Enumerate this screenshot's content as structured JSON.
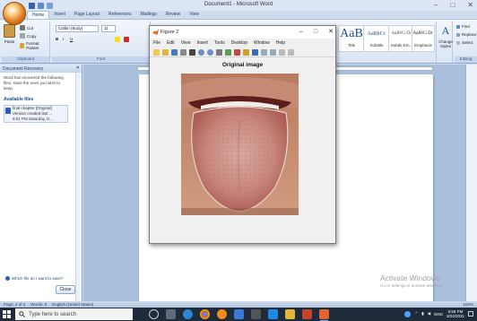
{
  "word": {
    "title": "Document1 - Microsoft Word",
    "window_controls": [
      "–",
      "□",
      "✕"
    ],
    "tabs": [
      "Home",
      "Insert",
      "Page Layout",
      "References",
      "Mailings",
      "Review",
      "View"
    ],
    "ribbon": {
      "clipboard": {
        "paste": "Paste",
        "cut": "Cut",
        "copy": "Copy",
        "format_painter": "Format Painter",
        "label": "Clipboard"
      },
      "font": {
        "name": "Calibri (Body)",
        "size": "11",
        "bold": "B",
        "italic": "I",
        "underline": "U",
        "label": "Font"
      },
      "styles": [
        {
          "sample": "AaB",
          "name": "Title"
        },
        {
          "sample": "AaBbCc",
          "name": "Subtitle"
        },
        {
          "sample": "AaBbCcDc",
          "name": "Subtle Em..."
        },
        {
          "sample": "AaBbCcDc",
          "name": "Emphasis"
        }
      ],
      "change_styles": "Change Styles",
      "editing": {
        "find": "Find",
        "replace": "Replace",
        "select": "Select",
        "label": "Editing"
      }
    },
    "recovery": {
      "title": "Document Recovery",
      "close_x": "✕",
      "description": "Word has recovered the following files. Save the ones you wish to keep.",
      "files_header": "Available files",
      "file": {
        "name": "final chapter [Original]",
        "detail": "Version created last ...",
        "time": "5:01 PM Saturday, D..."
      },
      "help_link": "Which file do I want to save?",
      "close_button": "Close"
    },
    "status": {
      "page": "Page: 4 of 4",
      "words": "Words: 0",
      "language": "English (United States)",
      "zoom": "100%"
    },
    "watermark": {
      "line1": "Activate Windows",
      "line2": "Go to Settings to activate Windows."
    }
  },
  "figure": {
    "title": "Figure 2",
    "controls": [
      "–",
      "□",
      "✕"
    ],
    "menu": [
      "File",
      "Edit",
      "View",
      "Insert",
      "Tools",
      "Desktop",
      "Window",
      "Help"
    ],
    "plot_title": "Original image"
  },
  "taskbar": {
    "search_placeholder": "Type here to search",
    "apps": [
      "task-view-icon",
      "file-explorer-icon",
      "edge-icon",
      "chrome-icon",
      "firefox-icon",
      "store-icon",
      "calculator-icon",
      "mail-icon",
      "photos-icon",
      "powerpoint-icon",
      "matlab-icon"
    ],
    "tray": {
      "lang": "ENG",
      "time": "5:56 PM",
      "date": "3/24/2021"
    }
  }
}
